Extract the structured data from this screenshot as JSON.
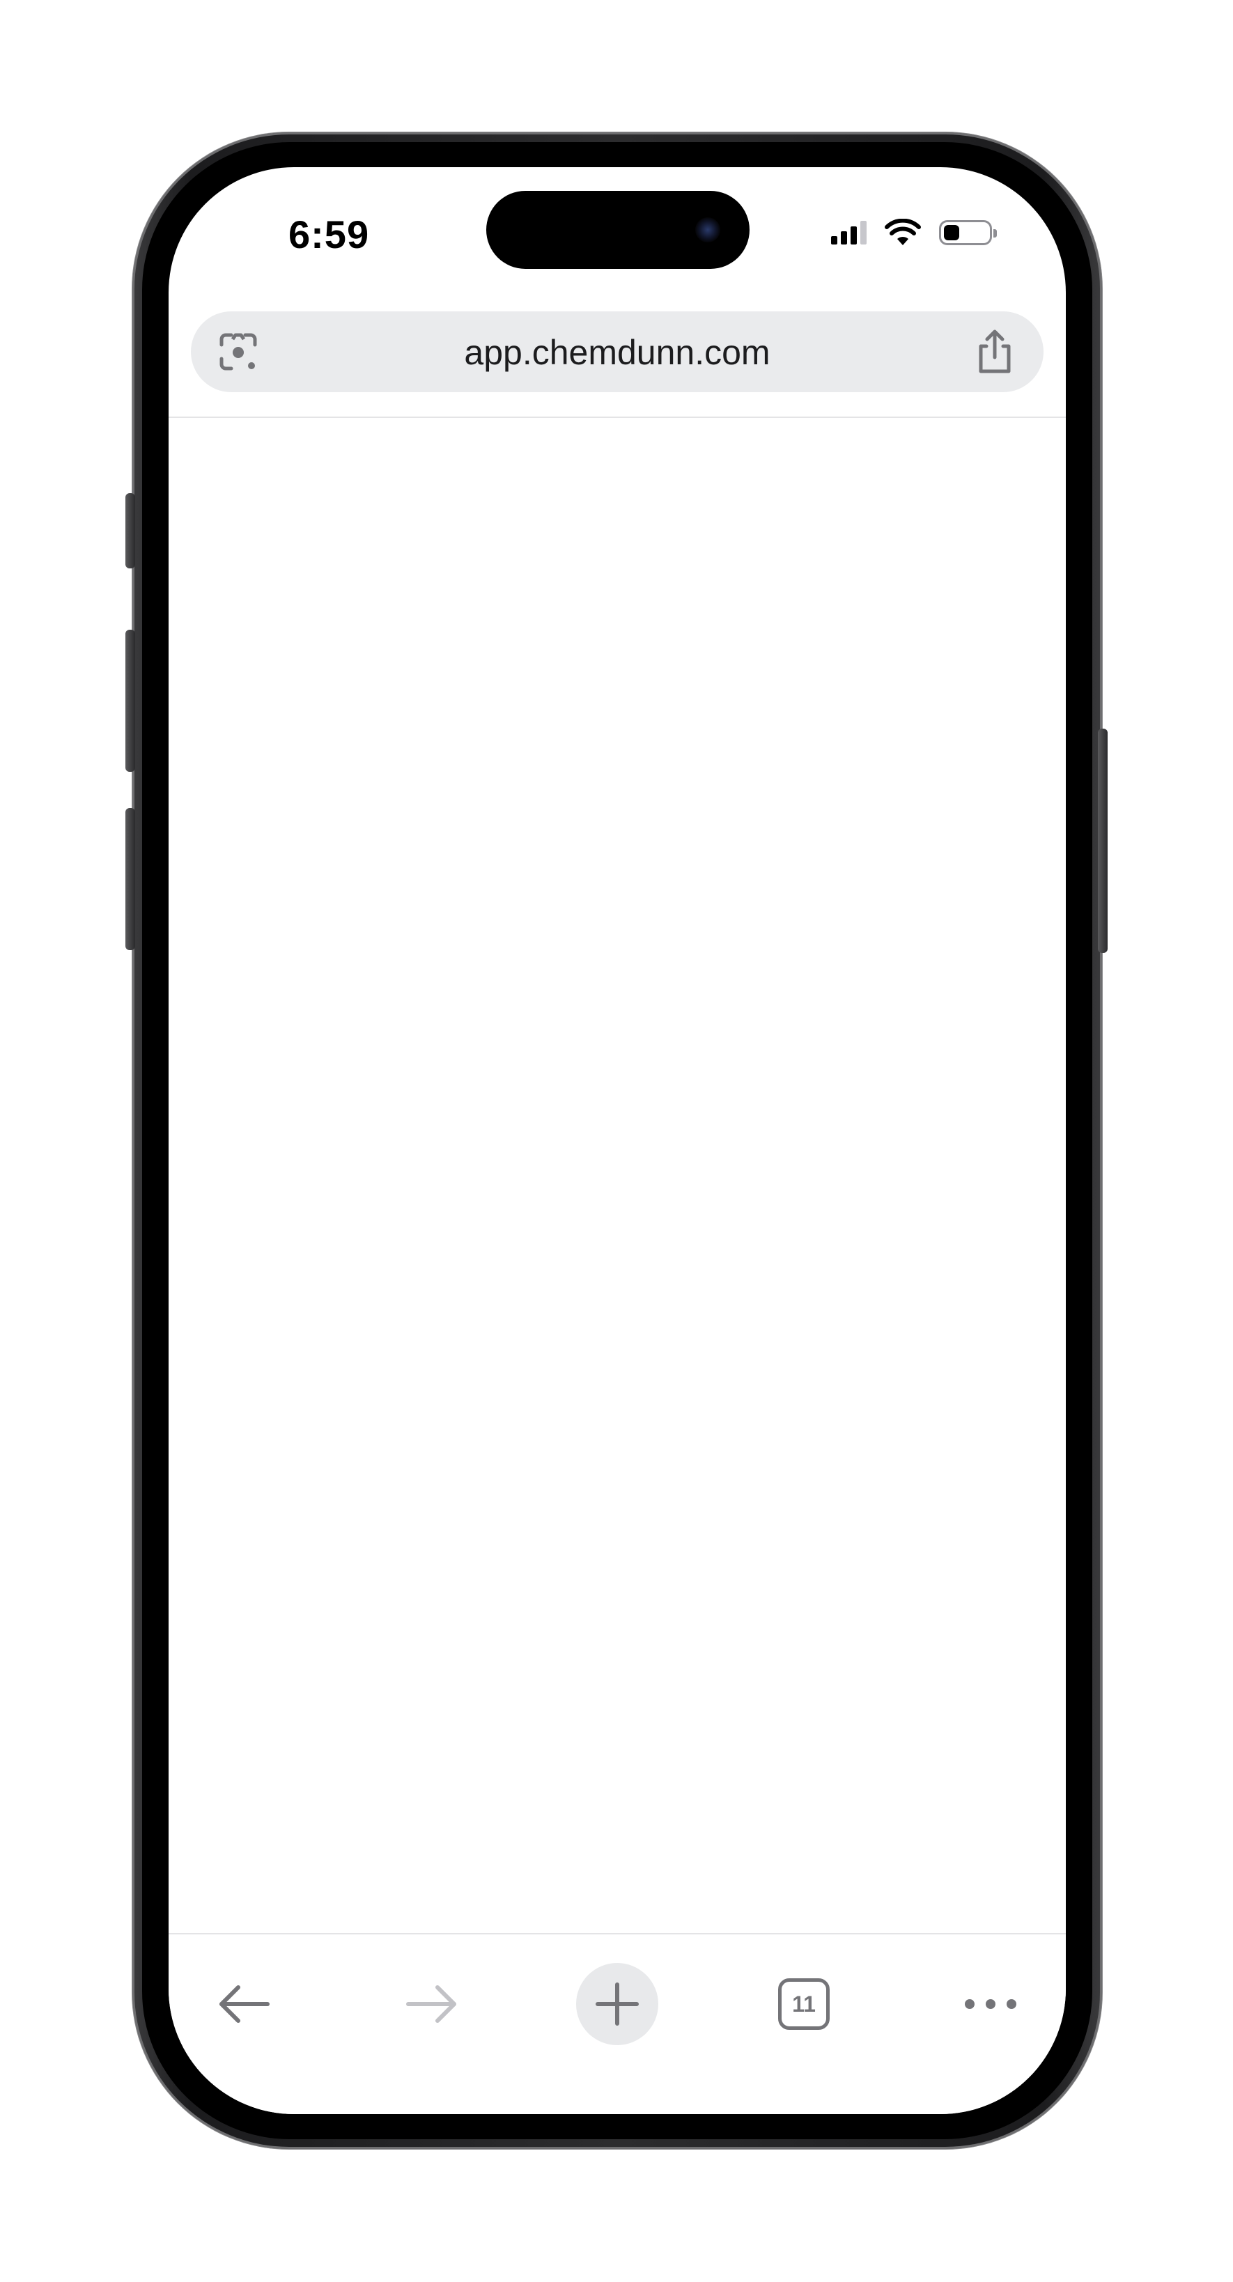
{
  "status_bar": {
    "time": "6:59",
    "signal_icon": "cellular-signal-icon",
    "wifi_icon": "wifi-icon",
    "battery_icon": "battery-icon",
    "battery_level": 0.35
  },
  "address_bar": {
    "url": "app.chemdunn.com",
    "lens_icon": "google-lens-icon",
    "share_icon": "share-icon"
  },
  "toolbar": {
    "back_icon": "back-arrow-icon",
    "forward_icon": "forward-arrow-icon",
    "new_tab_icon": "plus-icon",
    "tab_count": "11",
    "menu_icon": "more-dots-icon"
  },
  "colors": {
    "toolbar_icon": "#747478",
    "toolbar_icon_disabled": "#c2c2c6",
    "address_bar_bg": "#eaebed",
    "phone_frame": "#1c1c1e"
  }
}
